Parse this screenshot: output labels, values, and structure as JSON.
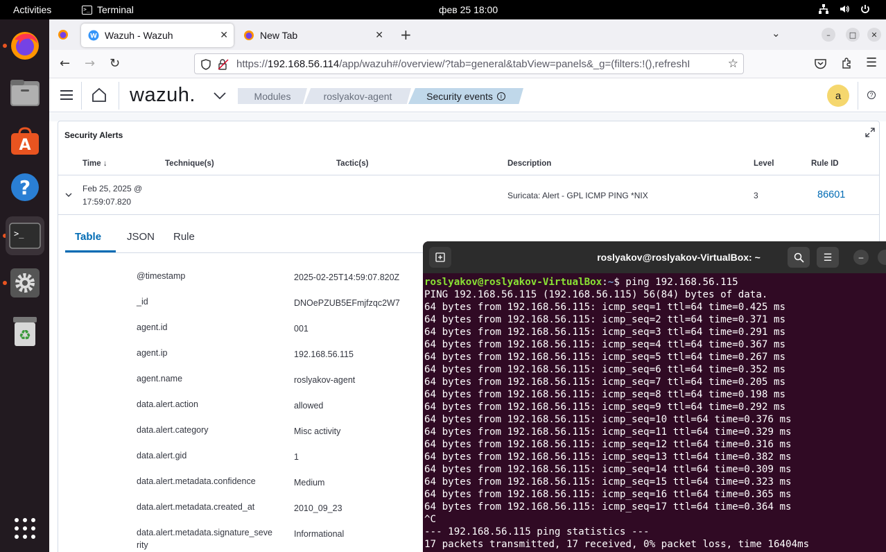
{
  "topbar": {
    "activities": "Activities",
    "app_name": "Terminal",
    "clock": "фев 25  18:00"
  },
  "browser": {
    "tabs": [
      {
        "title": "Wazuh - Wazuh",
        "active": true
      },
      {
        "title": "New Tab",
        "active": false
      }
    ],
    "url_prefix": "https://",
    "url_host": "192.168.56.114",
    "url_path": "/app/wazuh#/overview/?tab=general&tabView=panels&_g=(filters:!(),refreshI"
  },
  "wazuh": {
    "logo": "wazuh.",
    "breadcrumbs": [
      "Modules",
      "roslyakov-agent",
      "Security events"
    ],
    "avatar": "a"
  },
  "alerts": {
    "title": "Security Alerts",
    "columns": [
      "Time",
      "Technique(s)",
      "Tactic(s)",
      "Description",
      "Level",
      "Rule ID"
    ],
    "row": {
      "time_line1": "Feb 25, 2025 @",
      "time_line2": "17:59:07.820",
      "description": "Suricata: Alert - GPL ICMP PING *NIX",
      "level": "3",
      "rule_id": "86601"
    },
    "detail_tabs": [
      "Table",
      "JSON",
      "Rule"
    ],
    "fields": [
      {
        "key": "@timestamp",
        "value": "2025-02-25T14:59:07.820Z"
      },
      {
        "key": "_id",
        "value": "DNOePZUB5EFmjfzqc2W7"
      },
      {
        "key": "agent.id",
        "value": "001"
      },
      {
        "key": "agent.ip",
        "value": "192.168.56.115"
      },
      {
        "key": "agent.name",
        "value": "roslyakov-agent"
      },
      {
        "key": "data.alert.action",
        "value": "allowed"
      },
      {
        "key": "data.alert.category",
        "value": "Misc activity"
      },
      {
        "key": "data.alert.gid",
        "value": "1"
      },
      {
        "key": "data.alert.metadata.confidence",
        "value": "Medium"
      },
      {
        "key": "data.alert.metadata.created_at",
        "value": "2010_09_23"
      },
      {
        "key": "data.alert.metadata.signature_seve",
        "key2": "rity",
        "value": "Informational"
      }
    ]
  },
  "terminal": {
    "title": "roslyakov@roslyakov-VirtualBox: ~",
    "prompt_user": "roslyakov@roslyakov-VirtualBox",
    "prompt_sep": ":",
    "prompt_path": "~",
    "prompt_cmd": "$ ping 192.168.56.115",
    "lines": [
      "PING 192.168.56.115 (192.168.56.115) 56(84) bytes of data.",
      "64 bytes from 192.168.56.115: icmp_seq=1 ttl=64 time=0.425 ms",
      "64 bytes from 192.168.56.115: icmp_seq=2 ttl=64 time=0.371 ms",
      "64 bytes from 192.168.56.115: icmp_seq=3 ttl=64 time=0.291 ms",
      "64 bytes from 192.168.56.115: icmp_seq=4 ttl=64 time=0.367 ms",
      "64 bytes from 192.168.56.115: icmp_seq=5 ttl=64 time=0.267 ms",
      "64 bytes from 192.168.56.115: icmp_seq=6 ttl=64 time=0.352 ms",
      "64 bytes from 192.168.56.115: icmp_seq=7 ttl=64 time=0.205 ms",
      "64 bytes from 192.168.56.115: icmp_seq=8 ttl=64 time=0.198 ms",
      "64 bytes from 192.168.56.115: icmp_seq=9 ttl=64 time=0.292 ms",
      "64 bytes from 192.168.56.115: icmp_seq=10 ttl=64 time=0.376 ms",
      "64 bytes from 192.168.56.115: icmp_seq=11 ttl=64 time=0.329 ms",
      "64 bytes from 192.168.56.115: icmp_seq=12 ttl=64 time=0.316 ms",
      "64 bytes from 192.168.56.115: icmp_seq=13 ttl=64 time=0.382 ms",
      "64 bytes from 192.168.56.115: icmp_seq=14 ttl=64 time=0.309 ms",
      "64 bytes from 192.168.56.115: icmp_seq=15 ttl=64 time=0.323 ms",
      "64 bytes from 192.168.56.115: icmp_seq=16 ttl=64 time=0.365 ms",
      "64 bytes from 192.168.56.115: icmp_seq=17 ttl=64 time=0.364 ms",
      "^C",
      "--- 192.168.56.115 ping statistics ---",
      "17 packets transmitted, 17 received, 0% packet loss, time 16404ms"
    ]
  },
  "colors": {
    "wazuh_blue": "#006bb4",
    "terminal_bg": "#300a24",
    "prompt_green": "#8ae234",
    "prompt_blue": "#729fcf",
    "ubuntu_orange": "#e95420"
  }
}
